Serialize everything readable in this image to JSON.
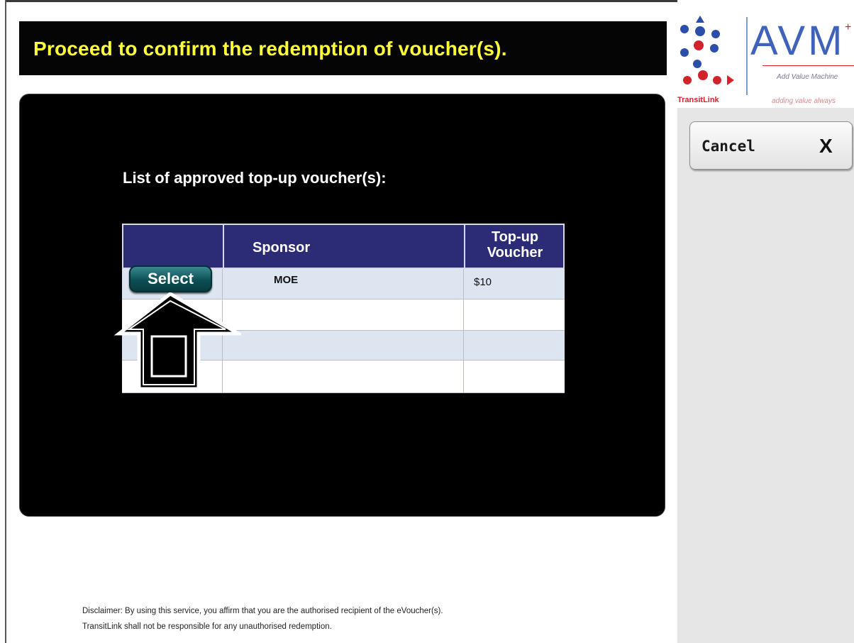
{
  "header": {
    "title": "Proceed to confirm the redemption of voucher(s)."
  },
  "main": {
    "list_heading": "List of approved top-up voucher(s):",
    "table": {
      "columns": [
        "",
        "Sponsor",
        "Top-up Voucher"
      ],
      "col_topup_line1": "Top-up",
      "col_topup_line2": "Voucher",
      "rows": [
        {
          "action": "Select",
          "sponsor": "MOE",
          "voucher": "$10"
        },
        {
          "action": "",
          "sponsor": "",
          "voucher": ""
        },
        {
          "action": "",
          "sponsor": "",
          "voucher": ""
        },
        {
          "action": "",
          "sponsor": "",
          "voucher": ""
        }
      ]
    }
  },
  "disclaimer": {
    "line1": "Disclaimer: By using this service, you affirm that you are the authorised recipient of the eVoucher(s).",
    "line2": "TransitLink shall not be responsible for any unauthorised redemption."
  },
  "sidebar": {
    "logo": {
      "brand": "TransitLink",
      "name": "AVM",
      "subtitle": "Add Value Machine",
      "tagline": "adding value always"
    },
    "cancel": {
      "label": "Cancel",
      "x": "X"
    }
  },
  "colors": {
    "title_yellow": "#ffff3a",
    "table_header": "#2c2c76",
    "select_button": "#0d4f55",
    "brand_red": "#d2232a",
    "brand_blue": "#3f63b8"
  },
  "icons": [
    "up-arrow-icon",
    "transitlink-dots-logo"
  ]
}
